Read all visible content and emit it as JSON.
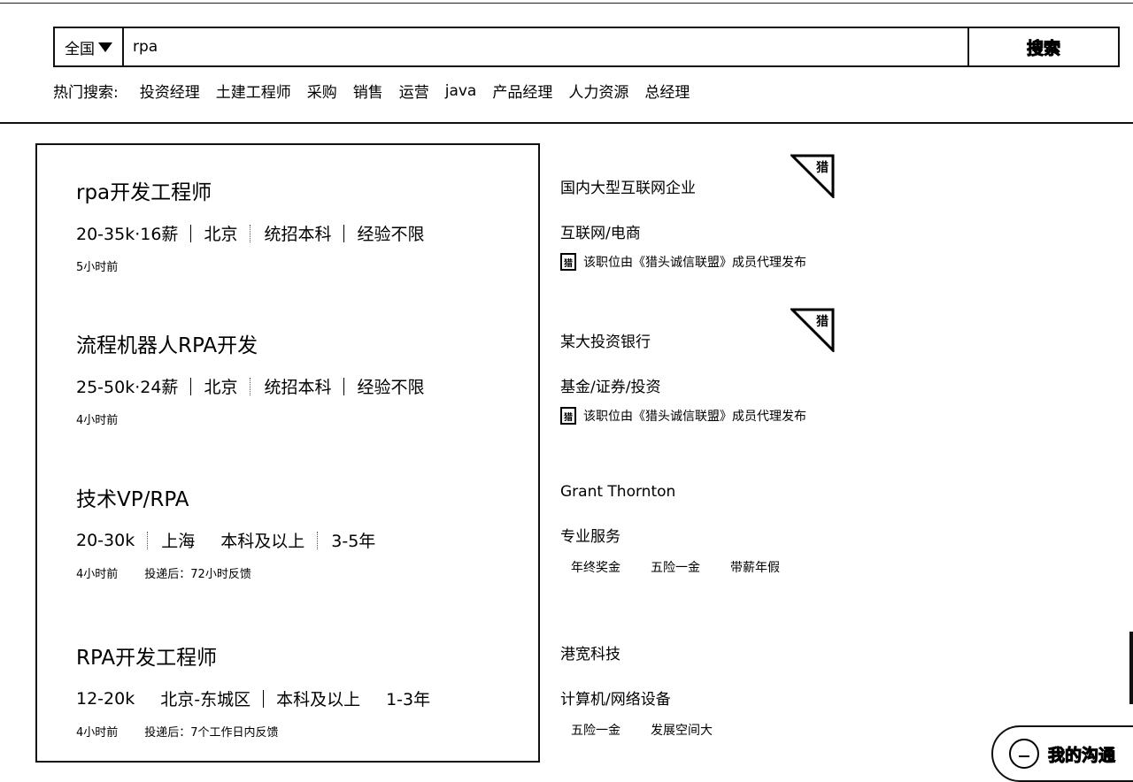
{
  "search": {
    "region": "全国",
    "query": "rpa",
    "button": "搜索"
  },
  "hot": {
    "label": "热门搜索:",
    "items": [
      "投资经理",
      "土建工程师",
      "采购",
      "销售",
      "运营",
      "java",
      "产品经理",
      "人力资源",
      "总经理"
    ]
  },
  "jobs": [
    {
      "title": "rpa开发工程师",
      "salary": "20-35k·16薪",
      "city": "北京",
      "edu": "统招本科",
      "exp": "经验不限",
      "time": "5小时前",
      "feedback": ""
    },
    {
      "title": "流程机器人RPA开发",
      "salary": "25-50k·24薪",
      "city": "北京",
      "edu": "统招本科",
      "exp": "经验不限",
      "time": "4小时前",
      "feedback": ""
    },
    {
      "title": "技术VP/RPA",
      "salary": "20-30k",
      "city": "上海",
      "edu": "本科及以上",
      "exp": "3-5年",
      "time": "4小时前",
      "feedback": "投递后：72小时反馈"
    },
    {
      "title": "RPA开发工程师",
      "salary": "12-20k",
      "city": "北京-东城区",
      "edu": "本科及以上",
      "exp": "1-3年",
      "time": "4小时前",
      "feedback": "投递后：7个工作日内反馈"
    }
  ],
  "companies": [
    {
      "name": "国内大型互联网企业",
      "industry": "互联网/电商",
      "note": "该职位由《猎头诚信联盟》成员代理发布",
      "badge": "猎",
      "tags": []
    },
    {
      "name": "某大投资银行",
      "industry": "基金/证券/投资",
      "note": "该职位由《猎头诚信联盟》成员代理发布",
      "badge": "猎",
      "tags": []
    },
    {
      "name": "Grant Thornton",
      "industry": "专业服务",
      "note": "",
      "badge": "",
      "tags": [
        "年终奖金",
        "五险一金",
        "带薪年假"
      ]
    },
    {
      "name": "港宽科技",
      "industry": "计算机/网络设备",
      "note": "",
      "badge": "",
      "tags": [
        "五险一金",
        "发展空间大"
      ]
    }
  ],
  "float": {
    "label": "我的沟通"
  },
  "icons": {
    "shield": "shield-icon",
    "chat": "chat-icon",
    "dropdown": "triangle-down-icon"
  }
}
